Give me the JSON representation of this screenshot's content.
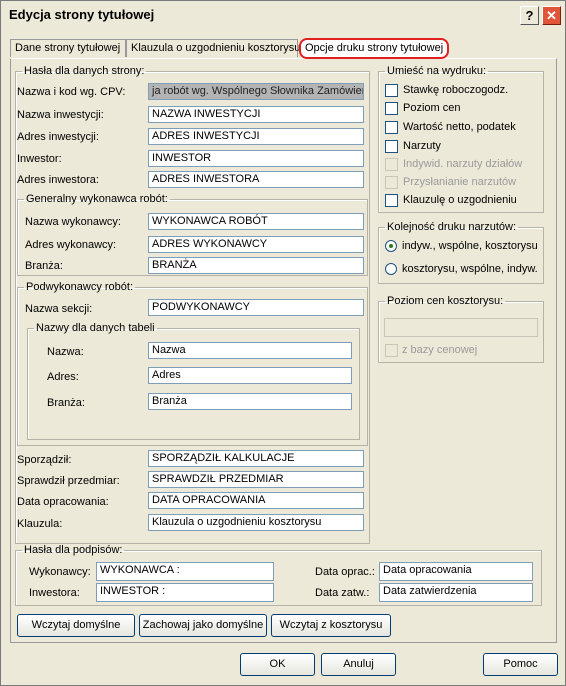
{
  "window": {
    "title": "Edycja strony tytułowej",
    "help_glyph": "?",
    "close_glyph": "✕"
  },
  "tabs": [
    {
      "label": "Dane strony tytułowej"
    },
    {
      "label": "Klauzula o uzgodnieniu kosztorysu"
    },
    {
      "label": "Opcje druku strony tytułowej"
    }
  ],
  "page_strings": {
    "legend": "Hasła dla danych strony:",
    "cpv_label": "Nazwa i kod wg. CPV:",
    "cpv_value": "ja robót wg. Wspólnego Słownika Zamówień",
    "inv_name_label": "Nazwa inwestycji:",
    "inv_name_value": "NAZWA INWESTYCJI",
    "inv_addr_label": "Adres inwestycji:",
    "inv_addr_value": "ADRES INWESTYCJI",
    "investor_label": "Inwestor:",
    "investor_value": "INWESTOR",
    "investor_addr_label": "Adres inwestora:",
    "investor_addr_value": "ADRES INWESTORA"
  },
  "contractor": {
    "legend": "Generalny wykonawca robót:",
    "name_label": "Nazwa wykonawcy:",
    "name_value": "WYKONAWCA ROBÓT",
    "addr_label": "Adres wykonawcy:",
    "addr_value": "ADRES WYKONAWCY",
    "branch_label": "Branża:",
    "branch_value": "BRANŻA"
  },
  "subcontractors": {
    "legend": "Podwykonawcy robót:",
    "section_label": "Nazwa sekcji:",
    "section_value": "PODWYKONAWCY",
    "table_legend": "Nazwy dla danych tabeli",
    "name_label": "Nazwa:",
    "name_value": "Nazwa",
    "addr_label": "Adres:",
    "addr_value": "Adres",
    "branch_label": "Branża:",
    "branch_value": "Branża"
  },
  "other": {
    "prepared_label": "Sporządził:",
    "prepared_value": "SPORZĄDZIŁ KALKULACJE",
    "checked_label": "Sprawdził przedmiar:",
    "checked_value": "SPRAWDZIŁ PRZEDMIAR",
    "date_label": "Data opracowania:",
    "date_value": "DATA OPRACOWANIA",
    "clause_label": "Klauzula:",
    "clause_value": "Klauzula o uzgodnieniu kosztorysu"
  },
  "print_options": {
    "legend": "Umieść na wydruku:",
    "items": [
      {
        "label": "Stawkę roboczogodz."
      },
      {
        "label": "Poziom cen"
      },
      {
        "label": "Wartość netto, podatek"
      },
      {
        "label": "Narzuty"
      },
      {
        "label": "Indywid. narzuty działów"
      },
      {
        "label": "Przysłanianie narzutów"
      },
      {
        "label": "Klauzulę o uzgodnieniu"
      }
    ]
  },
  "order": {
    "legend": "Kolejność druku narzutów:",
    "options": [
      {
        "label": "indyw., wspólne, kosztorysu"
      },
      {
        "label": "kosztorysu, wspólne, indyw."
      }
    ]
  },
  "price_level": {
    "legend": "Poziom cen kosztorysu:",
    "field_value": "",
    "checkbox_label": "z bazy cenowej"
  },
  "signatures": {
    "legend": "Hasła dla podpisów:",
    "contractor_label": "Wykonawcy:",
    "contractor_value": "WYKONAWCA :",
    "investor_label": "Inwestora:",
    "investor_value": "INWESTOR :",
    "date_prep_label": "Data oprac.:",
    "date_prep_value": "Data opracowania",
    "date_appr_label": "Data zatw.:",
    "date_appr_value": "Data zatwierdzenia"
  },
  "panel_buttons": {
    "load_defaults": "Wczytaj domyślne",
    "save_defaults": "Zachowaj jako domyślne",
    "load_estimate": "Wczytaj z kosztorysu"
  },
  "dialog_buttons": {
    "ok": "OK",
    "cancel": "Anuluj",
    "help": "Pomoc"
  },
  "colors": {
    "highlight": "#e32020",
    "readonly_field": "#b4b4b4"
  }
}
